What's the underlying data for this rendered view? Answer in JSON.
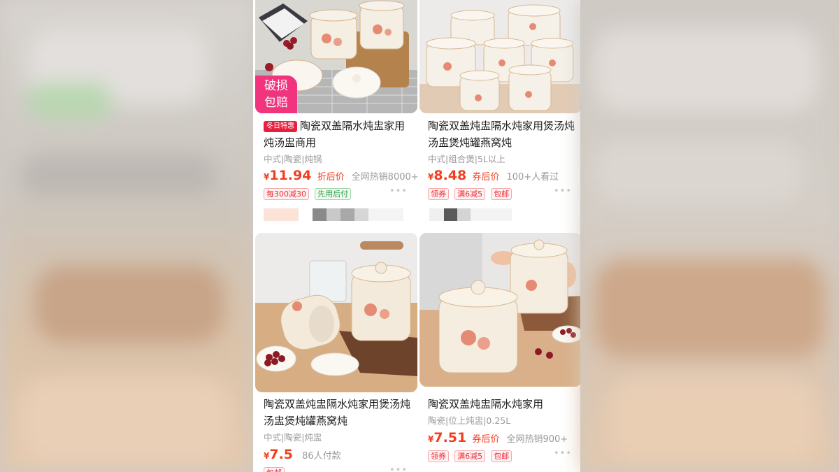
{
  "cards": [
    {
      "overlay_badge": [
        "破损",
        "包赔"
      ],
      "promo_tag": "冬日特惠",
      "title": "陶瓷双盖隔水炖盅家用炖汤盅商用",
      "attrs": "中式|陶瓷|炖锅",
      "price_symbol": "¥",
      "price": "11.94",
      "price_label": "折后价",
      "sales": "全网热销8000+",
      "badges": [
        {
          "text": "每300减30",
          "style": "red"
        },
        {
          "text": "先用后付",
          "style": "green"
        }
      ],
      "more": "•••"
    },
    {
      "title": "陶瓷双盖炖盅隔水炖家用煲汤炖汤盅煲炖罐燕窝炖",
      "attrs": "中式|组合煲|5L以上",
      "price_symbol": "¥",
      "price": "8.48",
      "price_label": "券后价",
      "sales": "100+人看过",
      "badges": [
        {
          "text": "领券",
          "style": "red"
        },
        {
          "text": "满6减5",
          "style": "red"
        },
        {
          "text": "包邮",
          "style": "red"
        }
      ],
      "more": "•••"
    },
    {
      "title": "陶瓷双盖炖盅隔水炖家用煲汤炖汤盅煲炖罐燕窝炖",
      "attrs": "中式|陶瓷|炖盅",
      "price_symbol": "¥",
      "price": "7.5",
      "price_label": "",
      "sales": "86人付款",
      "badges": [
        {
          "text": "包邮",
          "style": "red"
        }
      ],
      "more": "•••"
    },
    {
      "title": "陶瓷双盖炖盅隔水炖家用",
      "attrs": "陶瓷|位上炖盅|0.25L",
      "price_symbol": "¥",
      "price": "7.51",
      "price_label": "券后价",
      "sales": "全网热销900+",
      "badges": [
        {
          "text": "领券",
          "style": "red"
        },
        {
          "text": "满6减5",
          "style": "red"
        },
        {
          "text": "包邮",
          "style": "red"
        }
      ],
      "more": "•••"
    }
  ],
  "colors": {
    "price_red": "#f23e1f",
    "promo_red": "#e8203f",
    "overlay_pink": "#f0357e"
  }
}
